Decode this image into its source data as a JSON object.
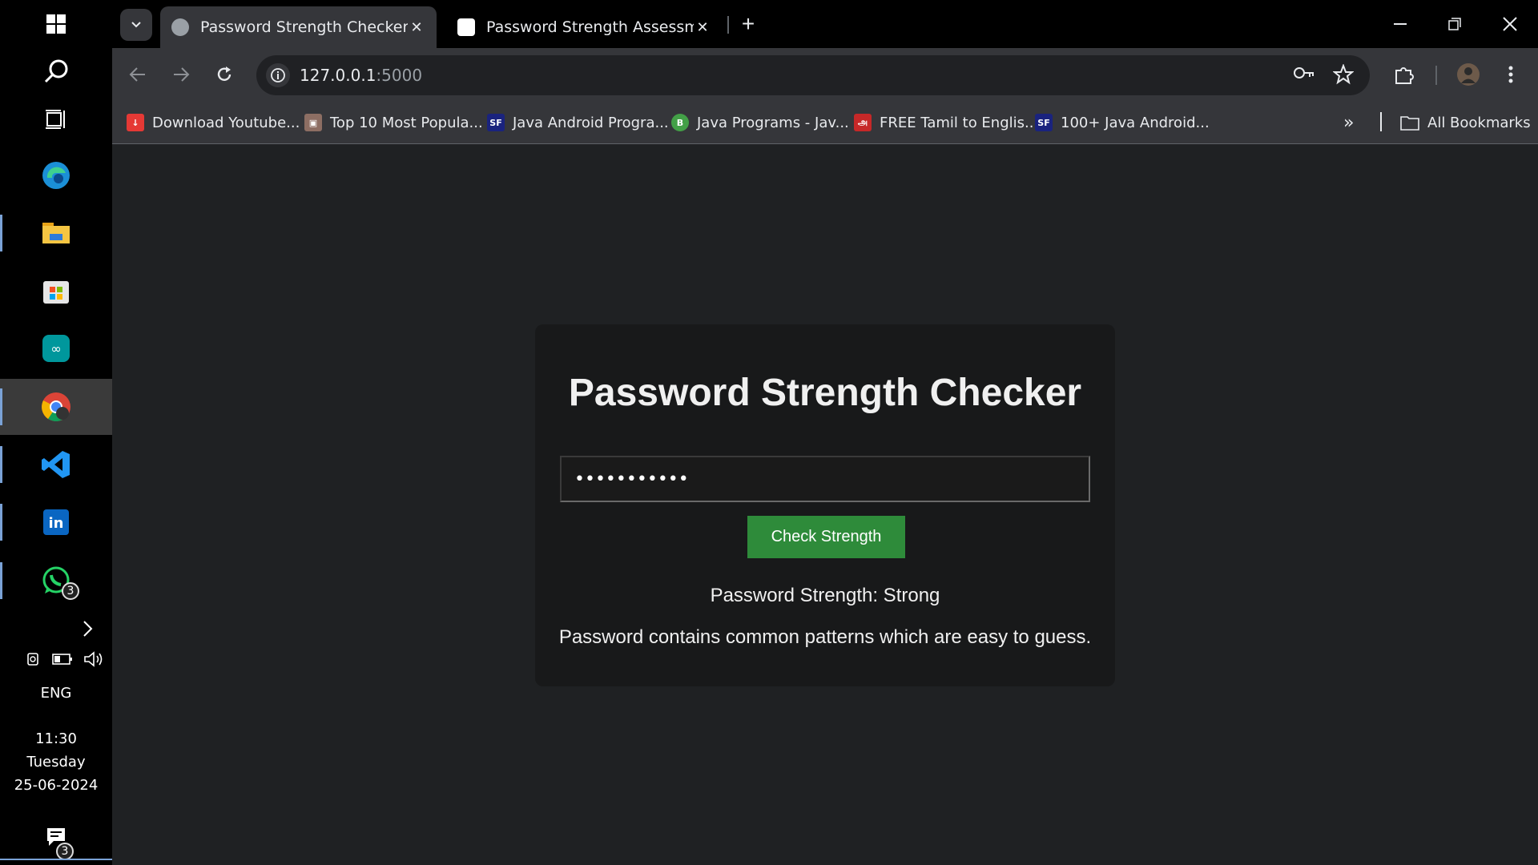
{
  "taskbar": {
    "language": "ENG",
    "clock": {
      "time": "11:30",
      "day": "Tuesday",
      "date": "25-06-2024"
    },
    "whatsapp_badge": "3",
    "notifications_badge": "3",
    "icons": [
      "windows-start-icon",
      "search-icon",
      "task-view-icon",
      "edge-icon",
      "file-explorer-icon",
      "store-icon",
      "arduino-icon",
      "chrome-icon",
      "vscode-icon",
      "linkedin-icon",
      "whatsapp-icon"
    ]
  },
  "browser": {
    "tabs": [
      {
        "title": "Password Strength Checker",
        "active": true
      },
      {
        "title": "Password Strength Assessment",
        "active": false
      }
    ],
    "address": {
      "host": "127.0.0.1",
      "port": ":5000"
    },
    "bookmarks": [
      {
        "label": "Download Youtube...",
        "color": "#e53935",
        "glyph": "↓"
      },
      {
        "label": "Top 10 Most Popula...",
        "color": "#8d6e63",
        "glyph": "▣"
      },
      {
        "label": "Java Android Progra...",
        "color": "#1a237e",
        "glyph": "SF"
      },
      {
        "label": "Java Programs - Jav...",
        "color": "#43a047",
        "glyph": "B"
      },
      {
        "label": "FREE Tamil to Englis...",
        "color": "#c62828",
        "glyph": "அ"
      },
      {
        "label": "100+ Java Android...",
        "color": "#1a237e",
        "glyph": "SF"
      }
    ],
    "all_bookmarks_label": "All Bookmarks"
  },
  "page": {
    "heading": "Password Strength Checker",
    "password_value": "•••••••••••",
    "button_label": "Check Strength",
    "strength_text": "Password Strength: Strong",
    "feedback_text": "Password contains common patterns which are easy to guess."
  },
  "colors": {
    "button": "#2e8b3a",
    "card": "#18191a",
    "page_bg": "#1f2123"
  }
}
